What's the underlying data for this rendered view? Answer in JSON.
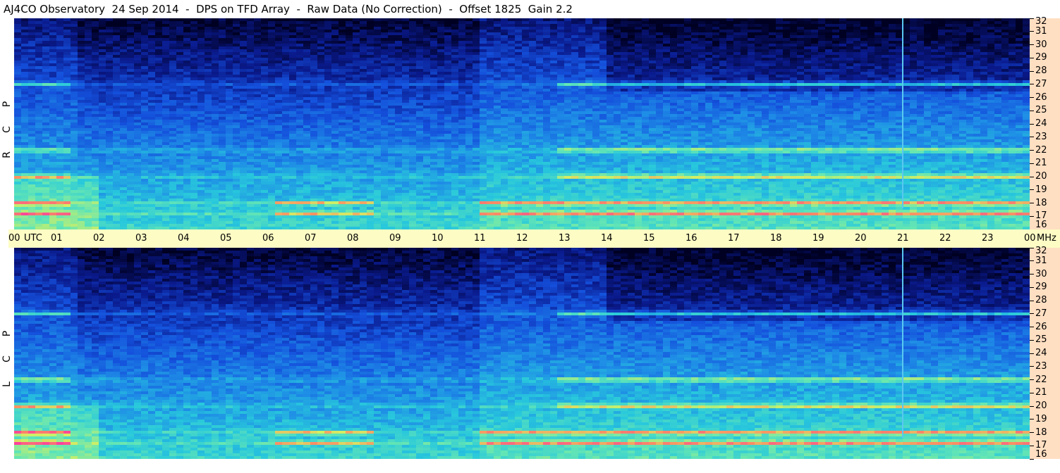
{
  "title": "AJ4CO Observatory  24 Sep 2014  -  DPS on TFD Array  -  Raw Data (No Correction)  -  Offset 1825  Gain 2.2",
  "panels": [
    {
      "label_chars": [
        "P",
        "C",
        "R"
      ]
    },
    {
      "label_chars": [
        "P",
        "C",
        "L"
      ]
    }
  ],
  "time_axis": {
    "labels": [
      "00",
      "01",
      "02",
      "03",
      "04",
      "05",
      "06",
      "07",
      "08",
      "09",
      "10",
      "11",
      "12",
      "13",
      "14",
      "15",
      "16",
      "17",
      "18",
      "19",
      "20",
      "21",
      "22",
      "23",
      "00"
    ],
    "utc_label": "UTC",
    "unit": "MHz"
  },
  "colors": {
    "time_axis_bg": "#fdfcc4",
    "freq_axis_bg": "#ffdfc2"
  },
  "chart_data": {
    "type": "heatmap",
    "title": "AJ4CO Observatory  24 Sep 2014  -  DPS on TFD Array  -  Raw Data (No Correction)  -  Offset 1825  Gain 2.2",
    "x": {
      "unit": "UTC hour",
      "range": [
        0,
        24
      ],
      "ticks": [
        "00",
        "01",
        "02",
        "03",
        "04",
        "05",
        "06",
        "07",
        "08",
        "09",
        "10",
        "11",
        "12",
        "13",
        "14",
        "15",
        "16",
        "17",
        "18",
        "19",
        "20",
        "21",
        "22",
        "23",
        "00"
      ]
    },
    "y": {
      "unit": "MHz",
      "range": [
        16,
        32
      ],
      "ticks": [
        16,
        17,
        18,
        19,
        20,
        21,
        22,
        23,
        24,
        25,
        26,
        27,
        28,
        29,
        30,
        31,
        32
      ]
    },
    "colormap": [
      "#000022",
      "#0a1a8c",
      "#1450dc",
      "#1e8ce6",
      "#28c8dc",
      "#64e6b4",
      "#d2f064",
      "#ff8c64",
      "#ff3ca0"
    ],
    "series": [
      {
        "name": "RCP",
        "description_bands_mhz": [
          27.0,
          22.0,
          20.0,
          18.0,
          17.2
        ]
      },
      {
        "name": "LCP",
        "description_bands_mhz": [
          27.0,
          22.0,
          20.0,
          18.0,
          17.2
        ]
      }
    ],
    "hour_groups": {
      "morning_strong": [
        0,
        1
      ],
      "night_quiet": [
        2,
        11
      ],
      "daytime_active": [
        11,
        24
      ]
    },
    "vertical_feature_hour": 21.0
  }
}
